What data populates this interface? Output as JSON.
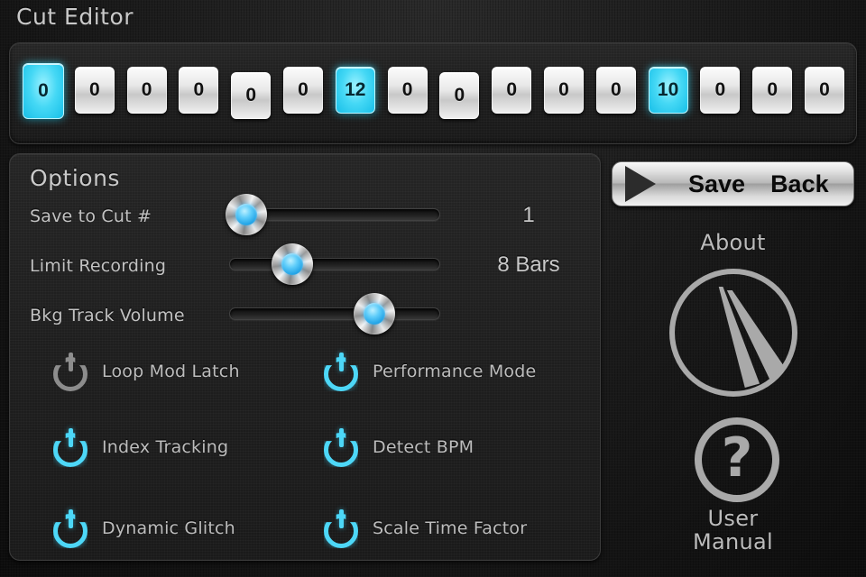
{
  "app": {
    "title": "Cut Editor",
    "accent_cyan": "#45d8f5",
    "text_gray": "#c2c2c2",
    "background": "#161616"
  },
  "cut_strip": {
    "name": "cut-slots",
    "slots": [
      {
        "value": "0",
        "active": true,
        "size": "tall",
        "offset": "normal"
      },
      {
        "value": "0",
        "active": false,
        "size": "normal",
        "offset": "normal"
      },
      {
        "value": "0",
        "active": false,
        "size": "normal",
        "offset": "normal"
      },
      {
        "value": "0",
        "active": false,
        "size": "normal",
        "offset": "normal"
      },
      {
        "value": "0",
        "active": false,
        "size": "normal",
        "offset": "low"
      },
      {
        "value": "0",
        "active": false,
        "size": "normal",
        "offset": "normal"
      },
      {
        "value": "12",
        "active": true,
        "size": "normal",
        "offset": "normal"
      },
      {
        "value": "0",
        "active": false,
        "size": "normal",
        "offset": "normal"
      },
      {
        "value": "0",
        "active": false,
        "size": "normal",
        "offset": "low"
      },
      {
        "value": "0",
        "active": false,
        "size": "normal",
        "offset": "normal"
      },
      {
        "value": "0",
        "active": false,
        "size": "normal",
        "offset": "normal"
      },
      {
        "value": "0",
        "active": false,
        "size": "normal",
        "offset": "normal"
      },
      {
        "value": "10",
        "active": true,
        "size": "normal",
        "offset": "normal"
      },
      {
        "value": "0",
        "active": false,
        "size": "normal",
        "offset": "normal"
      },
      {
        "value": "0",
        "active": false,
        "size": "normal",
        "offset": "normal"
      },
      {
        "value": "0",
        "active": false,
        "size": "normal",
        "offset": "normal"
      }
    ]
  },
  "options": {
    "title": "Options",
    "sliders": [
      {
        "label": "Save to Cut #",
        "value_text": "1",
        "percent": 8
      },
      {
        "label": "Limit Recording",
        "value_text": "8 Bars",
        "percent": 30
      },
      {
        "label": "Bkg Track Volume",
        "value_text": "",
        "percent": 69
      }
    ],
    "toggles": [
      {
        "label": "Loop Mod Latch",
        "on": false
      },
      {
        "label": "Performance Mode",
        "on": true
      },
      {
        "label": "Index Tracking",
        "on": true
      },
      {
        "label": "Detect BPM",
        "on": true
      },
      {
        "label": "Dynamic Glitch",
        "on": true
      },
      {
        "label": "Scale Time Factor",
        "on": true
      }
    ]
  },
  "rail": {
    "save_label": "Save",
    "back_label": "Back",
    "play_icon": "play-triangle-icon",
    "about_label": "About",
    "about_icon": "about-logo-icon",
    "manual_label_line1": "User",
    "manual_label_line2": "Manual",
    "manual_icon": "question-mark-icon",
    "manual_glyph": "?"
  }
}
